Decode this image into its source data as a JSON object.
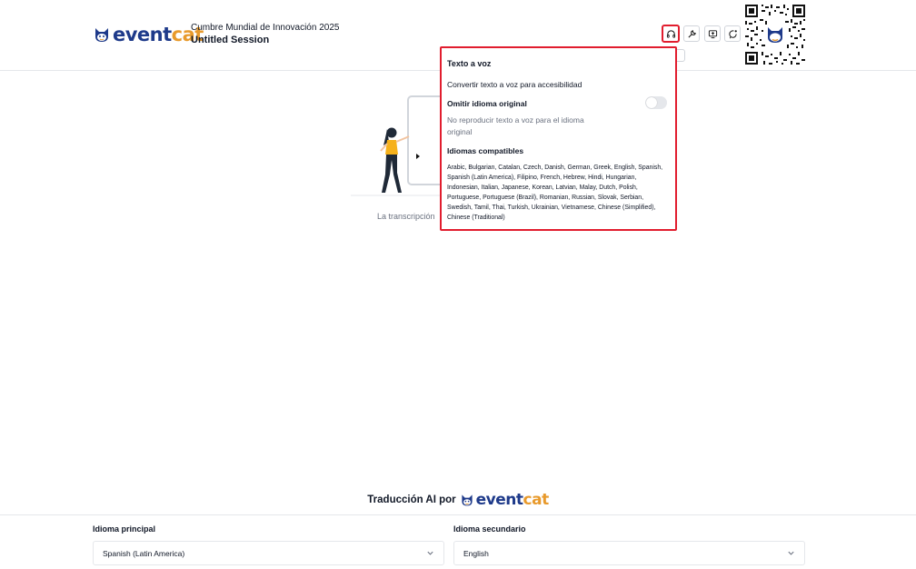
{
  "brand": {
    "part1": "event",
    "part2": "cat",
    "colors": {
      "primary": "#1e3a8a",
      "accent": "#e89a2c",
      "highlight": "#e11d2e"
    }
  },
  "header": {
    "event_name": "Cumbre Mundial de Innovación 2025",
    "session_name": "Untitled Session",
    "icons": [
      "headphones-icon",
      "wrench-icon",
      "screen-share-icon",
      "chat-icon"
    ]
  },
  "main": {
    "transcript_placeholder": "La transcripción"
  },
  "tts_popover": {
    "title": "Texto a voz",
    "description": "Convertir texto a voz para accesibilidad",
    "omit_title": "Omitir idioma original",
    "omit_desc": "No reproducir texto a voz para el idioma original",
    "omit_enabled": false,
    "languages_title": "Idiomas compatibles",
    "languages": "Arabic, Bulgarian, Catalan, Czech, Danish, German, Greek, English, Spanish, Spanish (Latin America), Filipino, French, Hebrew, Hindi, Hungarian, Indonesian, Italian, Japanese, Korean, Latvian, Malay, Dutch, Polish, Portuguese, Portuguese (Brazil), Romanian, Russian, Slovak, Serbian, Swedish, Tamil, Thai, Turkish, Ukrainian, Vietnamese, Chinese (Simplified), Chinese (Traditional)"
  },
  "footer": {
    "powered_by": "Traducción AI por",
    "primary_label": "Idioma principal",
    "primary_value": "Spanish (Latin America)",
    "secondary_label": "Idioma secundario",
    "secondary_value": "English"
  }
}
